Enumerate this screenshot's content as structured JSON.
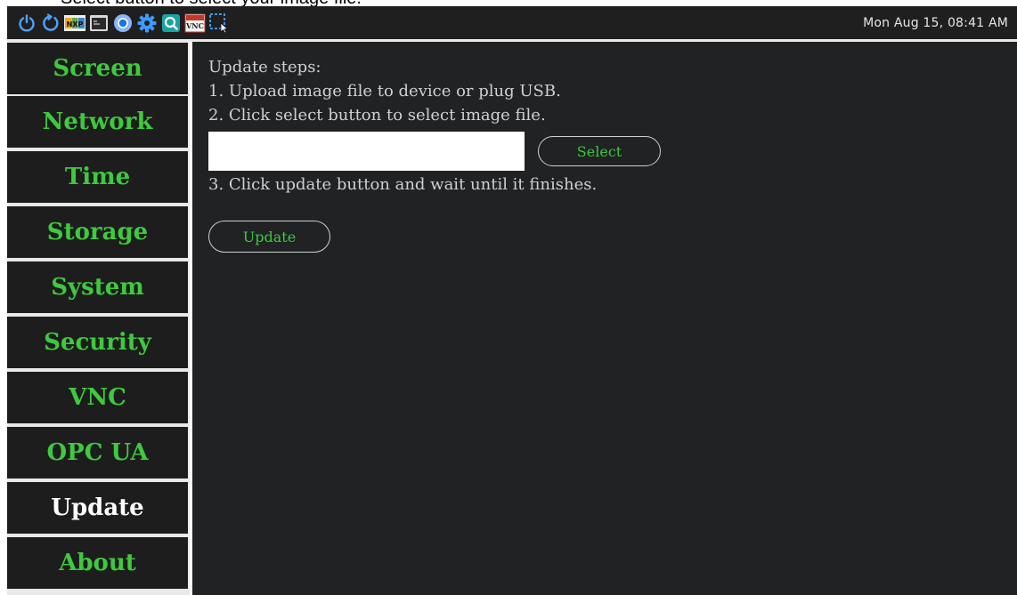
{
  "caption": "Select button to select your image file.",
  "taskbar": {
    "icons": [
      "power-icon",
      "restart-icon",
      "nxp-logo-icon",
      "terminal-icon",
      "chromium-icon",
      "settings-gear-icon",
      "search-app-icon",
      "vnc-app-icon",
      "screenshot-select-icon"
    ],
    "nxp_label": "NXP",
    "vnc_label": "VNC",
    "clock": "Mon Aug 15, 08:41 AM"
  },
  "sidebar": {
    "items": [
      {
        "label": "Screen"
      },
      {
        "label": "Network"
      },
      {
        "label": "Time"
      },
      {
        "label": "Storage"
      },
      {
        "label": "System"
      },
      {
        "label": "Security"
      },
      {
        "label": "VNC"
      },
      {
        "label": "OPC UA"
      },
      {
        "label": "Update",
        "active": true
      },
      {
        "label": "About"
      }
    ]
  },
  "main": {
    "heading": "Update steps:",
    "step1": "1. Upload image file to device or plug USB.",
    "step2": "2. Click select button to select image file.",
    "file_value": "",
    "select_label": "Select",
    "step3": "3. Click update button and wait until it finishes.",
    "update_label": "Update"
  },
  "colors": {
    "accent_green": "#3ec93e",
    "panel_bg": "#202224",
    "nav_bg": "#1d1d1d",
    "taskbar_bg": "#1f1f1f"
  }
}
